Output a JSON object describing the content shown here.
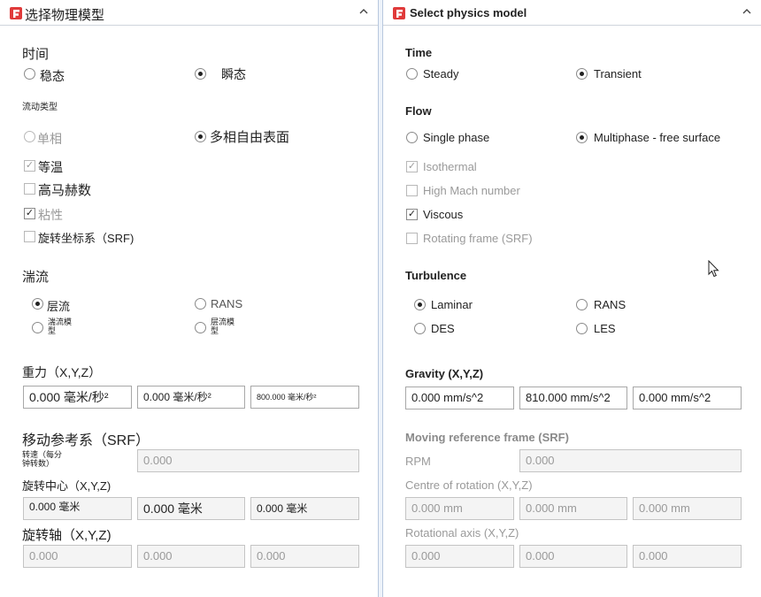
{
  "left": {
    "title": "选择物理模型",
    "time": {
      "heading": "时间",
      "steady": "稳态",
      "transient": "瞬态"
    },
    "flow": {
      "heading": "流动类型",
      "single": "单相",
      "multi": "多相自由表面",
      "isothermal": "等温",
      "high_mach": "高马赫数",
      "viscous": "粘性",
      "rotating": "旋转坐标系（SRF)"
    },
    "turbulence": {
      "heading": "湍流",
      "laminar": "层流",
      "rans": "RANS",
      "model1": "湍流模\n型",
      "model2": "层流模\n型"
    },
    "gravity": {
      "heading": "重力（X,Y,Z）",
      "x": "0.000 毫米/秒²",
      "y": "0.000 毫米/秒²",
      "z": "800.000 毫米/秒²"
    },
    "mrf": {
      "heading": "移动参考系（SRF）",
      "rpm_label": "转速（每分\n钟转数）",
      "rpm_value": "0.000",
      "center_label": "旋转中心（X,Y,Z)",
      "cx": "0.000 毫米",
      "cy": "0.000 毫米",
      "cz": "0.000 毫米",
      "axis_label": "旋转轴（X,Y,Z)",
      "ax": "0.000",
      "ay": "0.000",
      "az": "0.000"
    }
  },
  "right": {
    "title": "Select physics model",
    "time": {
      "heading": "Time",
      "steady": "Steady",
      "transient": "Transient"
    },
    "flow": {
      "heading": "Flow",
      "single": "Single phase",
      "multi": "Multiphase - free surface",
      "isothermal": "Isothermal",
      "high_mach": "High Mach number",
      "viscous": "Viscous",
      "rotating": "Rotating frame (SRF)"
    },
    "turbulence": {
      "heading": "Turbulence",
      "laminar": "Laminar",
      "rans": "RANS",
      "des": "DES",
      "les": "LES"
    },
    "gravity": {
      "heading": "Gravity (X,Y,Z)",
      "x": "0.000 mm/s^2",
      "y": "810.000 mm/s^2",
      "z": "0.000 mm/s^2"
    },
    "mrf": {
      "heading": "Moving reference frame (SRF)",
      "rpm_label": "RPM",
      "rpm_value": "0.000",
      "center_label": "Centre of rotation (X,Y,Z)",
      "cx": "0.000 mm",
      "cy": "0.000 mm",
      "cz": "0.000 mm",
      "axis_label": "Rotational axis (X,Y,Z)",
      "ax": "0.000",
      "ay": "0.000",
      "az": "0.000"
    }
  },
  "icons": {
    "logo": "app-logo-icon",
    "collapse": "chevron-up-icon",
    "cursor": "mouse-pointer-icon"
  },
  "colors": {
    "accent": "#e03a3a",
    "splitter": "#b8c8de",
    "disabled": "#9a9a9a"
  }
}
